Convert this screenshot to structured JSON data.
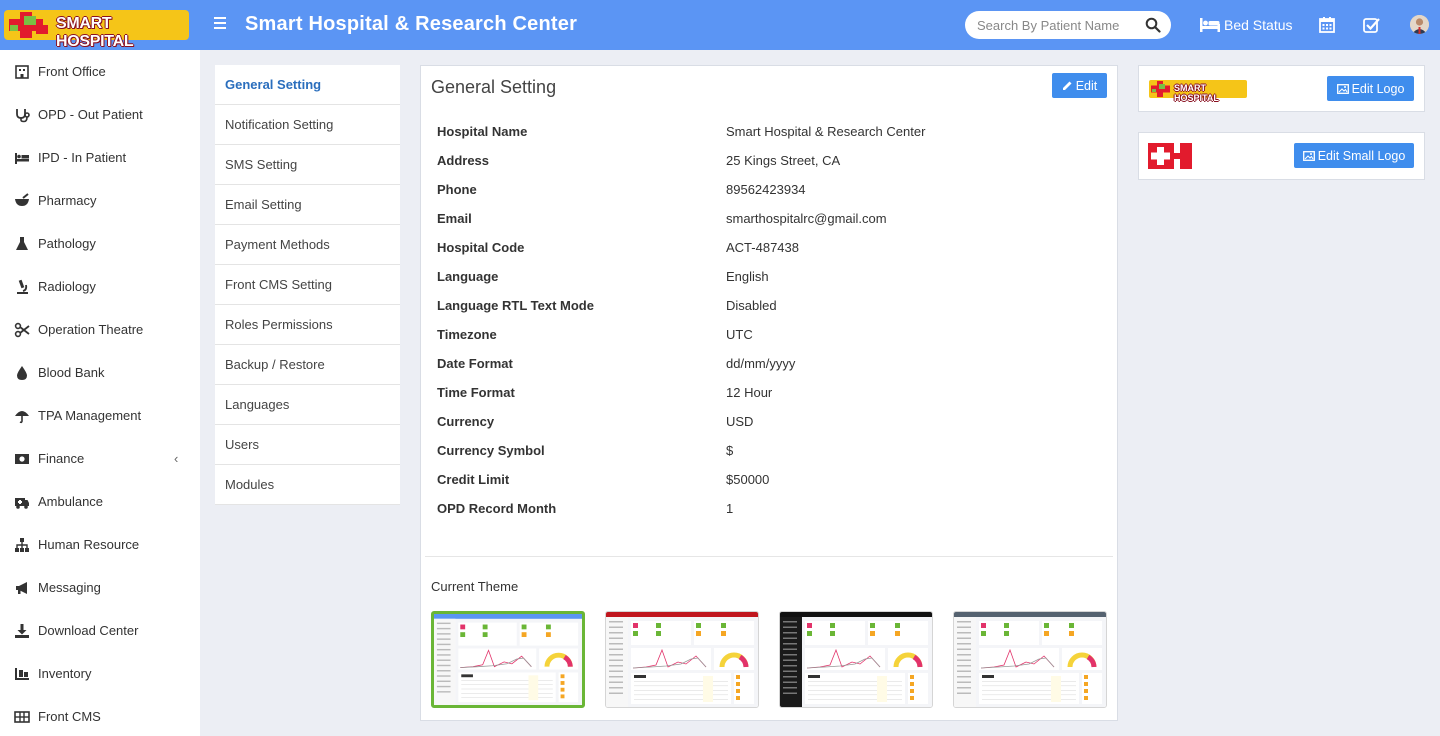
{
  "brand": {
    "logo_text": "SMART HOSPITAL",
    "colors": {
      "header": "#5b95f4",
      "accent": "#3f8ded",
      "logo_yellow": "#f5c518",
      "logo_red": "#e21b2d",
      "logo_green": "#7ac143",
      "theme_selected": "#6ab636"
    }
  },
  "header": {
    "title": "Smart Hospital & Research Center",
    "search_placeholder": "Search By Patient Name",
    "bed_status": "Bed Status",
    "icons": [
      "menu-icon",
      "search-icon",
      "bed-icon",
      "calendar-icon",
      "check-square-icon",
      "user-avatar"
    ]
  },
  "sidebar": {
    "items": [
      {
        "label": "Front Office",
        "icon": "building-icon"
      },
      {
        "label": "OPD - Out Patient",
        "icon": "stethoscope-icon"
      },
      {
        "label": "IPD - In Patient",
        "icon": "bed-icon"
      },
      {
        "label": "Pharmacy",
        "icon": "mortar-icon"
      },
      {
        "label": "Pathology",
        "icon": "flask-icon"
      },
      {
        "label": "Radiology",
        "icon": "microscope-icon"
      },
      {
        "label": "Operation Theatre",
        "icon": "scissors-icon"
      },
      {
        "label": "Blood Bank",
        "icon": "drop-icon"
      },
      {
        "label": "TPA Management",
        "icon": "umbrella-icon"
      },
      {
        "label": "Finance",
        "icon": "money-icon",
        "caret": "‹"
      },
      {
        "label": "Ambulance",
        "icon": "ambulance-icon"
      },
      {
        "label": "Human Resource",
        "icon": "sitemap-icon"
      },
      {
        "label": "Messaging",
        "icon": "bullhorn-icon"
      },
      {
        "label": "Download Center",
        "icon": "download-icon"
      },
      {
        "label": "Inventory",
        "icon": "inventory-icon"
      },
      {
        "label": "Front CMS",
        "icon": "grid-icon"
      }
    ]
  },
  "settings_nav": {
    "items": [
      "General Setting",
      "Notification Setting",
      "SMS Setting",
      "Email Setting",
      "Payment Methods",
      "Front CMS Setting",
      "Roles Permissions",
      "Backup / Restore",
      "Languages",
      "Users",
      "Modules"
    ],
    "active": "General Setting"
  },
  "general": {
    "title": "General Setting",
    "edit_label": "Edit",
    "fields": [
      {
        "label": "Hospital Name",
        "value": "Smart Hospital & Research Center"
      },
      {
        "label": "Address",
        "value": "25 Kings Street, CA"
      },
      {
        "label": "Phone",
        "value": "89562423934"
      },
      {
        "label": "Email",
        "value": "smarthospitalrc@gmail.com"
      },
      {
        "label": "Hospital Code",
        "value": "ACT-487438"
      },
      {
        "label": "Language",
        "value": "English"
      },
      {
        "label": "Language RTL Text Mode",
        "value": "Disabled"
      },
      {
        "label": "Timezone",
        "value": "UTC"
      },
      {
        "label": "Date Format",
        "value": "dd/mm/yyyy"
      },
      {
        "label": "Time Format",
        "value": "12 Hour"
      },
      {
        "label": "Currency",
        "value": "USD"
      },
      {
        "label": "Currency Symbol",
        "value": "$"
      },
      {
        "label": "Credit Limit",
        "value": "$50000"
      },
      {
        "label": "OPD Record Month",
        "value": "1"
      }
    ],
    "theme_title": "Current Theme",
    "themes": [
      {
        "name": "blue",
        "topbar": "#5b95f4",
        "sidebar": "#ffffff",
        "selected": true
      },
      {
        "name": "red",
        "topbar": "#c0161e",
        "sidebar": "#ffffff",
        "selected": false
      },
      {
        "name": "black",
        "topbar": "#111111",
        "sidebar": "#1a1a1a",
        "selected": false
      },
      {
        "name": "gray",
        "topbar": "#556270",
        "sidebar": "#ffffff",
        "selected": false
      }
    ]
  },
  "logos": {
    "edit_logo": "Edit Logo",
    "edit_small_logo": "Edit Small Logo"
  }
}
